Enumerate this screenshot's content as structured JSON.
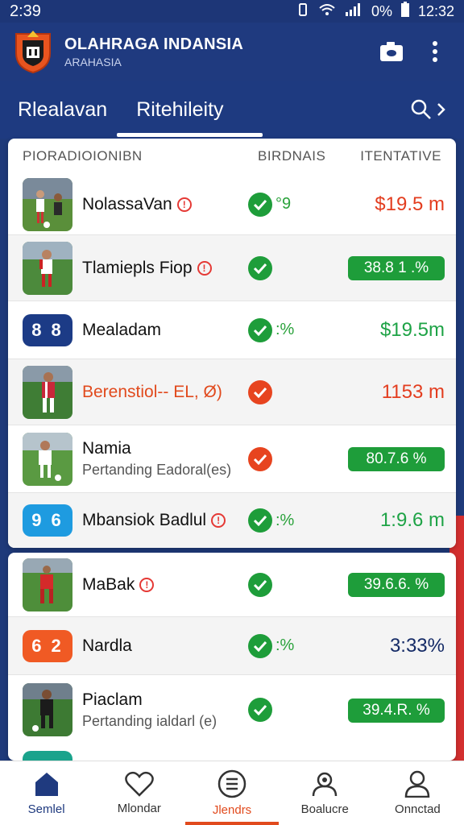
{
  "status_bar": {
    "time": "2:39",
    "battery": "0%",
    "clock": "12:32"
  },
  "app": {
    "title": "OLAHRAGA INDANSIA",
    "subtitle": "ARAHASIA"
  },
  "tabs": [
    {
      "label": "Rlealavan"
    },
    {
      "label": "Ritehileity"
    }
  ],
  "columns": {
    "name": "PIORADIOIONIBN",
    "status": "BIRDNAIS",
    "value": "ITENTATIVE"
  },
  "rows": [
    {
      "name": "NolassaVan",
      "warn": "⁕",
      "check": "green",
      "status_text": "°9",
      "value": "$19.5 m",
      "value_style": "red"
    },
    {
      "name": "Tlamiepls Fiop",
      "warn": "⁕",
      "check": "green",
      "status_text": "",
      "value": "38.8 1 .%",
      "value_style": "pill"
    },
    {
      "badge": "8 8",
      "name": "Mealadam",
      "check": "green",
      "status_text": ":%",
      "value": "$19.5m",
      "value_style": "green"
    },
    {
      "name": "Berenstiol-- EL, Ø)",
      "check": "red",
      "status_text": "",
      "value": "1153 m",
      "value_style": "red"
    },
    {
      "name": "Namia",
      "sub": "Pertanding Eadoral(es)",
      "check": "red",
      "status_text": "",
      "value": "80.7.6 %",
      "value_style": "pill"
    },
    {
      "badge": "9 6",
      "name": "Mbansiok Badlul",
      "warn": "⁕",
      "check": "green",
      "status_text": ":%",
      "value": "1:9.6 m",
      "value_style": "green"
    },
    {
      "name": "MaBak",
      "warn": "⁕",
      "check": "green",
      "status_text": "",
      "value": "39.6.6. %",
      "value_style": "pill"
    },
    {
      "badge": "6 2",
      "name": "Nardla",
      "check": "green",
      "status_text": ":%",
      "value": "3:33%",
      "value_style": "navy"
    },
    {
      "name": "Piaclam",
      "sub": "Pertanding ialdarl (e)",
      "check": "green",
      "status_text": "",
      "value": "39.4.R. %",
      "value_style": "pill"
    }
  ],
  "bottom_nav": [
    {
      "label": "Semlel",
      "icon": "home-icon"
    },
    {
      "label": "Mlondar",
      "icon": "heart-icon"
    },
    {
      "label": "Jlendrs",
      "icon": "document-icon"
    },
    {
      "label": "Boalucre",
      "icon": "people-icon"
    },
    {
      "label": "Onnctad",
      "icon": "person-icon"
    }
  ],
  "colors": {
    "navy": "#1f3a7f",
    "green": "#1e9d3a",
    "red": "#e33d1f"
  }
}
